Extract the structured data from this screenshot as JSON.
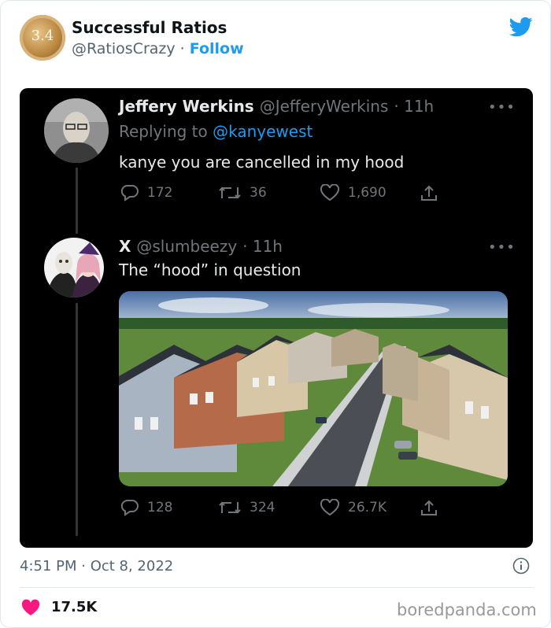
{
  "author": {
    "name": "Successful Ratios",
    "handle": "@RatiosCrazy",
    "separator": "·",
    "follow_label": "Follow",
    "avatar_text": "3.4"
  },
  "screenshot": {
    "tweet1": {
      "name": "Jeffery Werkins",
      "handle": "@JefferyWerkins",
      "time": "· 11h",
      "replying_prefix": "Replying to",
      "replying_to": "@kanyewest",
      "text": "kanye you are cancelled in my hood",
      "replies": "172",
      "retweets": "36",
      "likes": "1,690",
      "more": "•••"
    },
    "tweet2": {
      "name": "X",
      "handle": "@slumbeezy",
      "time": "· 11h",
      "text": "The “hood” in question",
      "replies": "128",
      "retweets": "324",
      "likes": "26.7K",
      "more": "•••"
    }
  },
  "footer": {
    "timestamp": "4:51 PM · Oct 8, 2022",
    "likes": "17.5K",
    "watermark": "boredpanda.com"
  },
  "colors": {
    "brand_blue": "#1d9bf0",
    "like_red": "#f91880",
    "dark_bg": "#000000"
  }
}
